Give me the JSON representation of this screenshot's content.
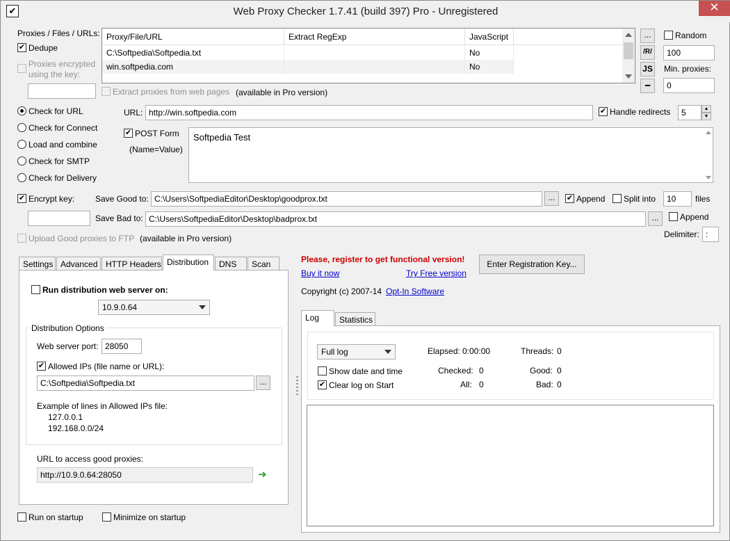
{
  "window": {
    "title": "Web Proxy Checker 1.7.41 (build 397) Pro - Unregistered",
    "close_glyph": "✕"
  },
  "proxies": {
    "label": "Proxies / Files / URLs:",
    "dedupe": "Dedupe",
    "encrypted": "Proxies encrypted using the key:",
    "extract_from_web": "Extract proxies from web pages",
    "pro_note": "(available in Pro version)",
    "columns": [
      "Proxy/File/URL",
      "Extract RegExp",
      "JavaScript"
    ],
    "rows": [
      [
        "C:\\Softpedia\\Softpedia.txt",
        "",
        "No"
      ],
      [
        "win.softpedia.com",
        "",
        "No"
      ]
    ],
    "side_buttons": {
      "more": "...",
      "regex": "/R/",
      "js": "JS",
      "remove": "━"
    }
  },
  "random": {
    "label": "Random",
    "value": "100",
    "min_label": "Min. proxies:",
    "min_value": "0"
  },
  "modes": [
    {
      "label": "Check for URL",
      "checked": true
    },
    {
      "label": "Check for Connect",
      "checked": false
    },
    {
      "label": "Load and combine",
      "checked": false
    },
    {
      "label": "Check for SMTP",
      "checked": false
    },
    {
      "label": "Check for Delivery",
      "checked": false
    }
  ],
  "url": {
    "label": "URL:",
    "value": "http://win.softpedia.com",
    "handle_redirects": "Handle redirects",
    "redirects": "5"
  },
  "post": {
    "label": "POST Form",
    "sublabel": "(Name=Value)",
    "value": "Softpedia Test"
  },
  "save": {
    "encrypt_key": "Encrypt key:",
    "good_label": "Save Good to:",
    "good_path": "C:\\Users\\SoftpediaEditor\\Desktop\\goodprox.txt",
    "bad_label": "Save Bad to:",
    "bad_path": "C:\\Users\\SoftpediaEditor\\Desktop\\badprox.txt",
    "append": "Append",
    "split": "Split into",
    "split_value": "10",
    "files": "files",
    "append2": "Append",
    "delimiter": "Delimiter:",
    "delimiter_value": ":",
    "browse": "...",
    "upload_ftp": "Upload Good proxies to FTP",
    "pro_note": "(available in Pro version)"
  },
  "tabs": [
    "Settings",
    "Advanced",
    "HTTP Headers",
    "Distribution",
    "DNS",
    "Scan"
  ],
  "distribution": {
    "run_server": "Run distribution web server on:",
    "ip": "10.9.0.64",
    "options_title": "Distribution Options",
    "port_label": "Web server port:",
    "port": "28050",
    "allowed_ips": "Allowed IPs (file name or URL):",
    "allowed_file": "C:\\Softpedia\\Softpedia.txt",
    "example_title": "Example of lines in Allowed IPs file:",
    "example_1": "127.0.0.1",
    "example_2": "192.168.0.0/24",
    "url_label": "URL to access good proxies:",
    "url_value": "http://10.9.0.64:28050",
    "go_glyph": "➜"
  },
  "footer": {
    "run_startup": "Run on startup",
    "minimize_startup": "Minimize on startup"
  },
  "register": {
    "warning": "Please, register to get functional version!",
    "buy": "Buy it now",
    "try": "Try Free version",
    "enter_key": "Enter Registration Key...",
    "copyright": "Copyright (c) 2007-14",
    "company": "Opt-In Software"
  },
  "log": {
    "tabs": [
      "Log",
      "Statistics"
    ],
    "mode": "Full log",
    "show_date": "Show date and time",
    "clear_log": "Clear log on Start",
    "elapsed_label": "Elapsed:",
    "elapsed": "0:00:00",
    "threads_label": "Threads:",
    "threads": "0",
    "checked_label": "Checked:",
    "checked": "0",
    "good_label": "Good:",
    "good": "0",
    "all_label": "All:",
    "all": "0",
    "bad_label": "Bad:",
    "bad": "0"
  },
  "colors": {
    "warning": "#cc0000",
    "link": "#0000cc",
    "close": "#c75050"
  }
}
